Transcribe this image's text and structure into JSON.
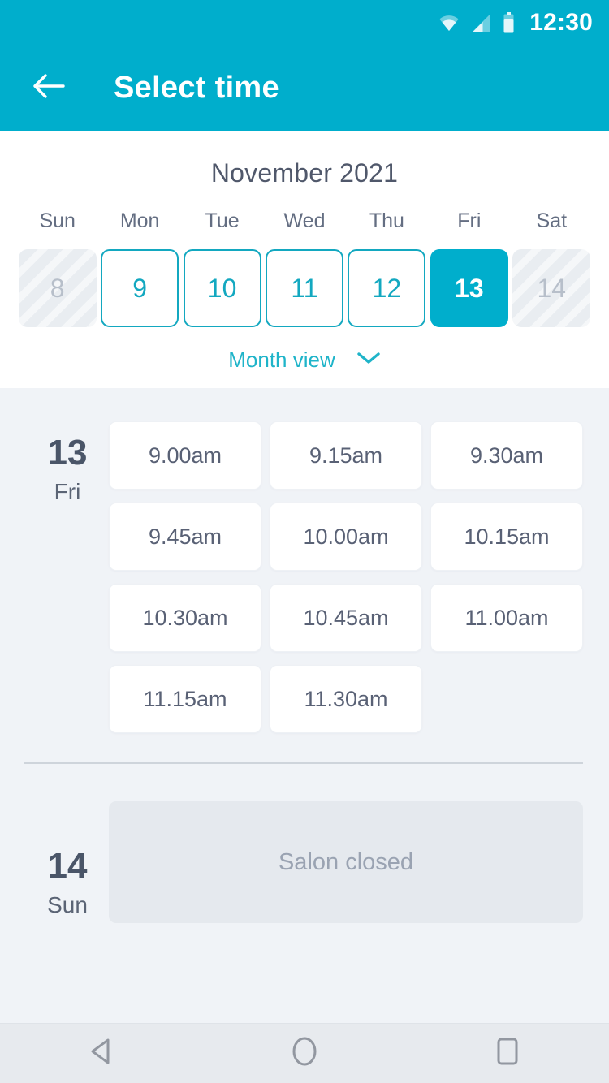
{
  "status_bar": {
    "time": "12:30",
    "icons": [
      "wifi-icon",
      "cellular-signal-icon",
      "battery-icon"
    ]
  },
  "app_bar": {
    "title": "Select time",
    "back_icon": "arrow-left-icon"
  },
  "calendar": {
    "month_title": "November 2021",
    "weekdays": [
      "Sun",
      "Mon",
      "Tue",
      "Wed",
      "Thu",
      "Fri",
      "Sat"
    ],
    "dates": [
      {
        "day": "8",
        "state": "disabled"
      },
      {
        "day": "9",
        "state": "available"
      },
      {
        "day": "10",
        "state": "available"
      },
      {
        "day": "11",
        "state": "available"
      },
      {
        "day": "12",
        "state": "available"
      },
      {
        "day": "13",
        "state": "selected"
      },
      {
        "day": "14",
        "state": "disabled"
      }
    ],
    "month_view_label": "Month view",
    "month_view_chevron": "chevron-down-icon"
  },
  "schedule": {
    "days": [
      {
        "day_number": "13",
        "day_of_week": "Fri",
        "slots": [
          "9.00am",
          "9.15am",
          "9.30am",
          "9.45am",
          "10.00am",
          "10.15am",
          "10.30am",
          "10.45am",
          "11.00am",
          "11.15am",
          "11.30am"
        ]
      },
      {
        "day_number": "14",
        "day_of_week": "Sun",
        "closed_message": "Salon closed"
      }
    ]
  },
  "nav_bar": {
    "back_icon": "triangle-back-icon",
    "home_icon": "circle-home-icon",
    "recents_icon": "square-recents-icon"
  },
  "colors": {
    "brand_teal": "#00AECC",
    "accent_teal": "#13a8c0",
    "page_bg": "#f0f3f7",
    "text_dark": "#4a5568",
    "text_muted": "#9aa3b2"
  }
}
